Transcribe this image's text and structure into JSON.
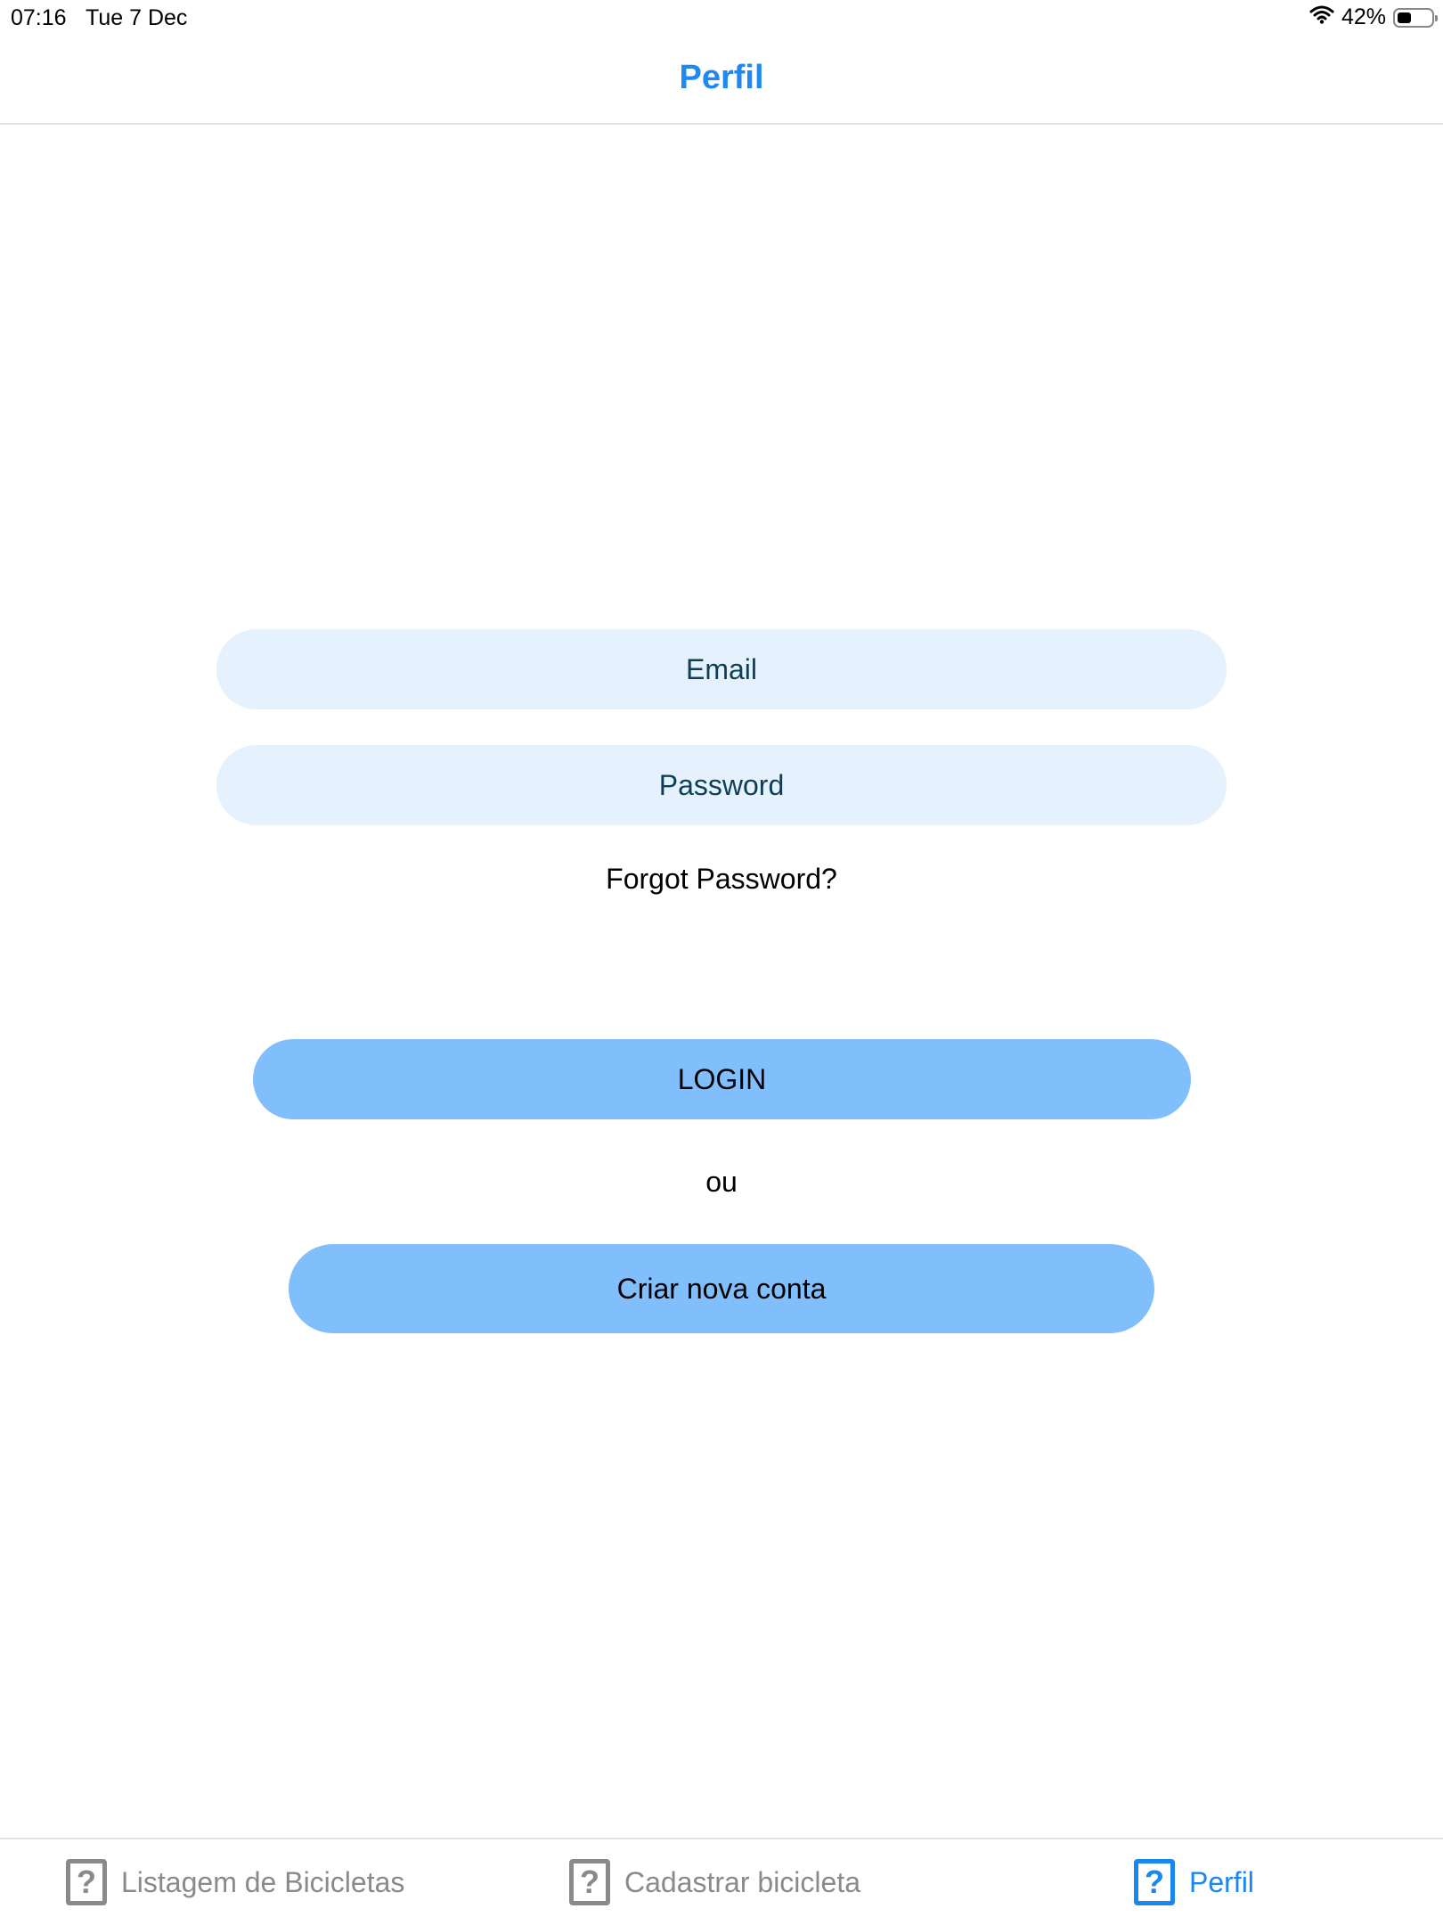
{
  "status_bar": {
    "time": "07:16",
    "date": "Tue 7 Dec",
    "battery_percent": "42%",
    "battery_level": 0.42,
    "wifi_icon": "wifi-icon",
    "battery_icon": "battery-icon"
  },
  "header": {
    "title": "Perfil",
    "title_color": "#2089f0"
  },
  "form": {
    "email_placeholder": "Email",
    "password_placeholder": "Password",
    "forgot_password": "Forgot Password?",
    "field_bg": "#e5f1fd"
  },
  "actions": {
    "login_label": "LOGIN",
    "or_label": "ou",
    "create_account_label": "Criar nova conta",
    "button_bg": "#80befc"
  },
  "tab_bar": {
    "items": [
      {
        "label": "Listagem de Bicicletas",
        "icon": "question-icon",
        "active": false
      },
      {
        "label": "Cadastrar bicicleta",
        "icon": "question-icon",
        "active": false
      },
      {
        "label": "Perfil",
        "icon": "question-icon",
        "active": true
      }
    ],
    "active_color": "#1a86f0",
    "inactive_color": "#8a8a8a"
  }
}
